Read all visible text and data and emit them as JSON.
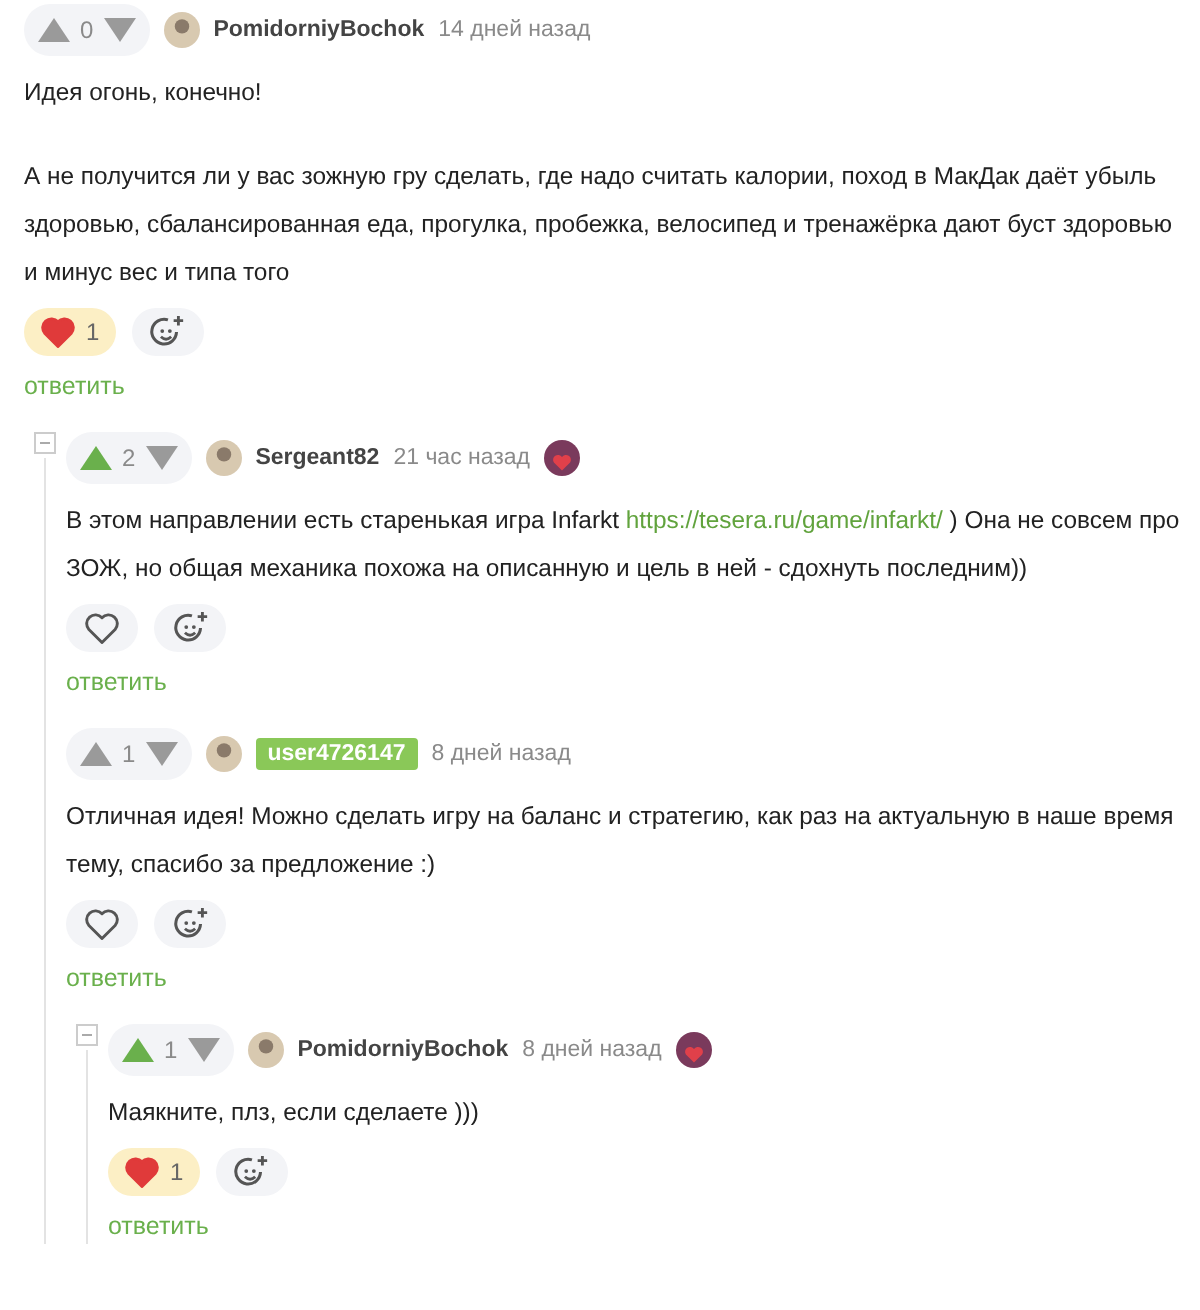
{
  "comments": [
    {
      "rating": {
        "score": "0",
        "upvoted": false
      },
      "author": {
        "name": "PomidorniyBochok",
        "highlighted": false
      },
      "time": "14 дней назад",
      "award": false,
      "paragraphs": [
        [
          {
            "kind": "text",
            "text": "Идея огонь, конечно!"
          }
        ],
        [
          {
            "kind": "text",
            "text": "А не получится ли у вас зожную гру сделать, где надо считать калории, поход в МакДак даёт убыль здоровью, сбалансированная еда, прогулка, пробежка, велосипед и тренажёрка дают буст здоровью и минус вес и типа того"
          }
        ]
      ],
      "reaction": {
        "liked": true,
        "count": "1"
      },
      "reply": "ответить",
      "children": [
        {
          "rating": {
            "score": "2",
            "upvoted": true
          },
          "author": {
            "name": "Sergeant82",
            "highlighted": false
          },
          "time": "21 час назад",
          "award": true,
          "paragraphs": [
            [
              {
                "kind": "text",
                "text": "В этом направлении есть старенькая игра Infarkt "
              },
              {
                "kind": "link",
                "text": "https://tesera.ru/game/infarkt/"
              },
              {
                "kind": "text",
                "text": " ) Она не совсем про ЗОЖ, но общая механика похожа на описанную и цель в ней - сдохнуть последним))"
              }
            ]
          ],
          "reaction": {
            "liked": false
          },
          "reply": "ответить"
        },
        {
          "rating": {
            "score": "1",
            "upvoted": false
          },
          "author": {
            "name": "user4726147",
            "highlighted": true
          },
          "time": "8 дней назад",
          "award": false,
          "paragraphs": [
            [
              {
                "kind": "text",
                "text": "Отличная идея! Можно сделать игру на баланс и стратегию, как раз на актуальную в наше время тему, спасибо за предложение :)"
              }
            ]
          ],
          "reaction": {
            "liked": false
          },
          "reply": "ответить",
          "children": [
            {
              "rating": {
                "score": "1",
                "upvoted": true
              },
              "author": {
                "name": "PomidorniyBochok",
                "highlighted": false
              },
              "time": "8 дней назад",
              "award": true,
              "paragraphs": [
                [
                  {
                    "kind": "text",
                    "text": "Маякните, плз, если сделаете )))"
                  }
                ]
              ],
              "reaction": {
                "liked": true,
                "count": "1"
              },
              "reply": "ответить"
            }
          ]
        }
      ]
    }
  ]
}
